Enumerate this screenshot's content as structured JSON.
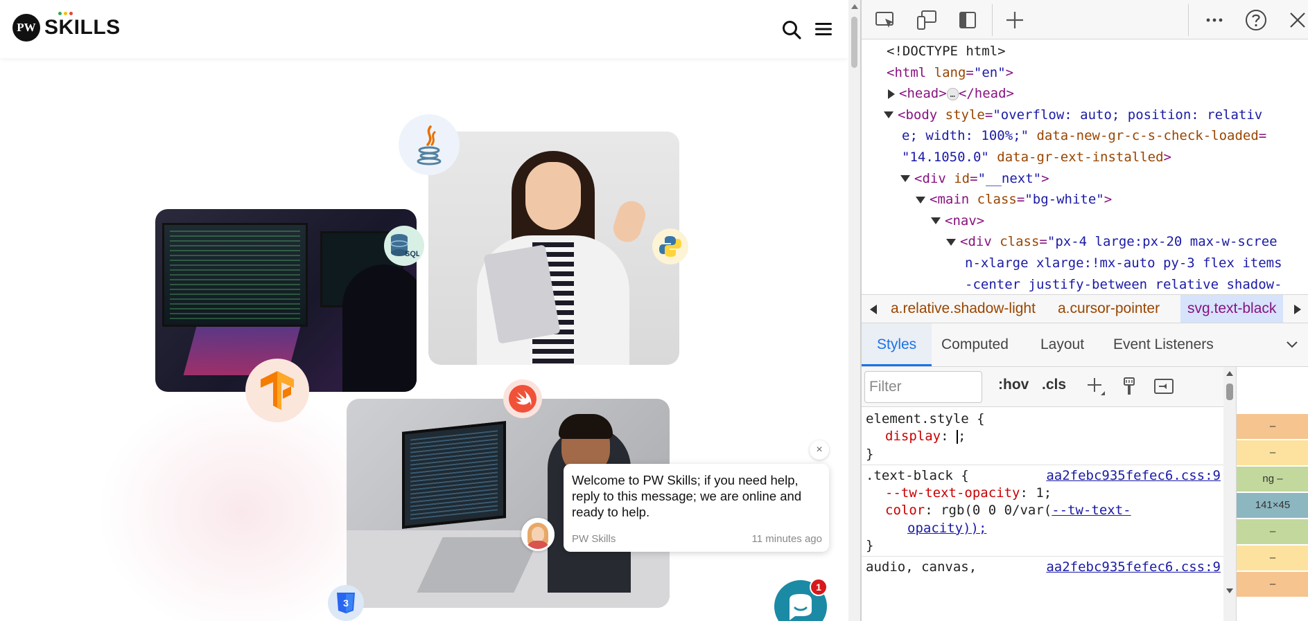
{
  "site": {
    "logo": {
      "mark": "PW",
      "text": "SKILLS",
      "dot_colors": [
        "#34a853",
        "#fbbc05",
        "#ea4335"
      ]
    },
    "nav": {
      "search_icon": "search-icon",
      "menu_icon": "menu-icon"
    },
    "chat": {
      "message": "Welcome to PW Skills; if you need help, reply to this message; we are online and ready to help.",
      "sender": "PW Skills",
      "time": "11 minutes ago",
      "close_label": "×",
      "unread_count": "1"
    },
    "tech_icons": [
      "java-icon",
      "sql-icon",
      "python-icon",
      "tensorflow-icon",
      "swift-icon",
      "css3-icon"
    ],
    "sql_label": "SQL"
  },
  "devtools": {
    "toolbar": {
      "inspect_icon": "inspect-element-icon",
      "device_icon": "device-toolbar-icon",
      "dock_icon": "dock-side-icon",
      "new_tab_icon": "plus-icon",
      "more_icon": "more-icon",
      "help_icon": "help-icon",
      "close_icon": "close-icon"
    },
    "dom": {
      "doctype": "<!DOCTYPE html>",
      "html_open": "<html",
      "html_attr": "lang",
      "html_val": "\"en\"",
      "head_open": "<head>",
      "head_close": "</head>",
      "head_ellipsis": "…",
      "body_open": "<body",
      "body_attr1": "style",
      "body_val1a": "\"overflow: auto; position: relativ",
      "body_val1b": "e; width: 100%;\"",
      "body_attr2": "data-new-gr-c-s-check-loaded",
      "body_eq": "=",
      "body_val2": "\"14.1050.0\"",
      "body_attr3": "data-gr-ext-installed",
      "div_open": "<div",
      "div_attr": "id",
      "div_val": "\"__next\"",
      "main_open": "<main",
      "main_attr": "class",
      "main_val": "\"bg-white\"",
      "nav_open": "<nav>",
      "div2_open": "<div",
      "div2_attr": "class",
      "div2_val_a": "\"px-4 large:px-20 max-w-scree",
      "div2_val_b": "n-xlarge xlarge:!mx-auto py-3 flex items",
      "div2_val_c": "-center justify-between relative shadow-",
      "close_bracket": ">"
    },
    "breadcrumbs": [
      {
        "label": "a.relative.shadow-light",
        "active": false
      },
      {
        "label": "a.cursor-pointer",
        "active": false
      },
      {
        "label": "svg.text-black",
        "active": true
      }
    ],
    "tabs": [
      "Styles",
      "Computed",
      "Layout",
      "Event Listeners"
    ],
    "styles_toolbar": {
      "filter_placeholder": "Filter",
      "hov": ":hov",
      "cls": ".cls"
    },
    "rules": {
      "element_selector": "element.style {",
      "element_prop": "display",
      "element_sep": ": ",
      "element_value": ";",
      "close": "}",
      "text_black_selector": ".text-black {",
      "text_black_link": "aa2febc935fefec6.css:9",
      "tw_prop": "--tw-text-opacity",
      "tw_value": ": 1;",
      "color_prop": "color",
      "color_value_a": ": rgb(0 0 0/var(",
      "color_var": "--tw-text-",
      "color_value_b": "opacity));",
      "audio_selector": "audio, canvas,",
      "audio_link": "aa2febc935fefec6.css:9"
    },
    "box_model": {
      "rows": [
        {
          "label": "–",
          "color": "#f6c48f"
        },
        {
          "label": "–",
          "color": "#fce29e"
        },
        {
          "label": "ng  –",
          "color": "#c3d89c"
        },
        {
          "label": "141×45",
          "color": "#8cb6c0"
        },
        {
          "label": "–",
          "color": "#c3d89c"
        },
        {
          "label": "–",
          "color": "#fce29e"
        },
        {
          "label": "–",
          "color": "#f6c48f"
        }
      ]
    }
  }
}
